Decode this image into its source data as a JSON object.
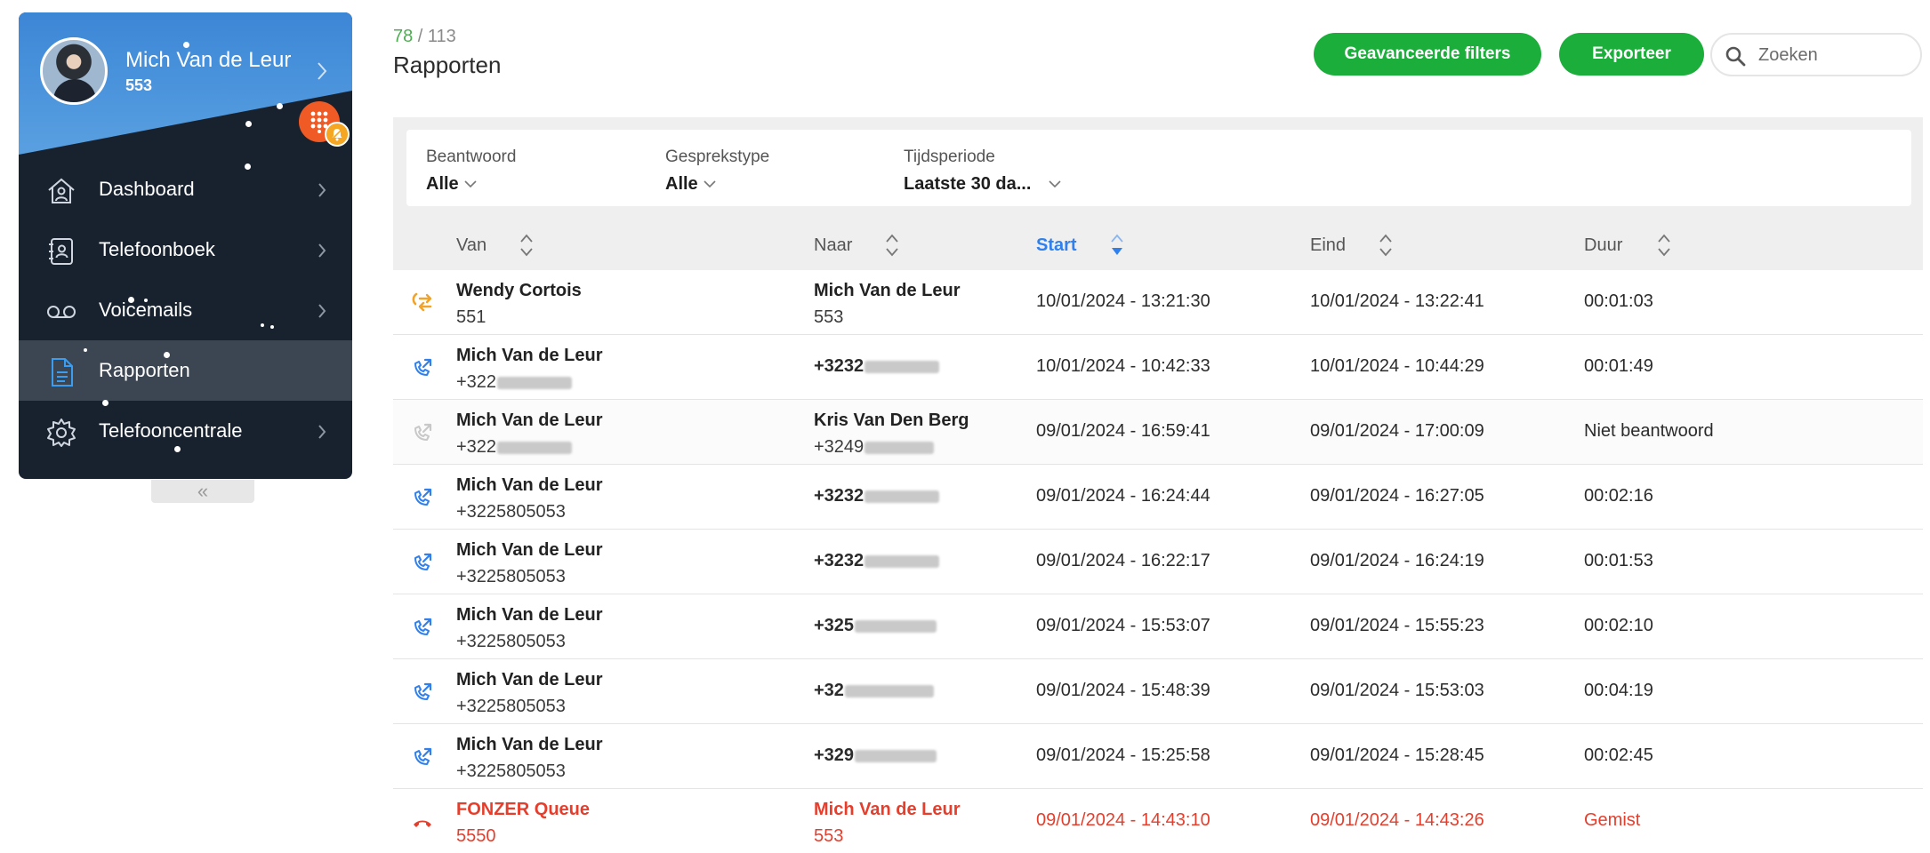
{
  "sidebar": {
    "user_name": "Mich Van de Leur",
    "user_ext": "553",
    "nav": [
      {
        "label": "Dashboard",
        "icon": "home-icon",
        "active": false
      },
      {
        "label": "Telefoonboek",
        "icon": "contacts-icon",
        "active": false
      },
      {
        "label": "Voicemails",
        "icon": "voicemail-icon",
        "active": false
      },
      {
        "label": "Rapporten",
        "icon": "document-icon",
        "active": true
      },
      {
        "label": "Telefooncentrale",
        "icon": "gear-icon",
        "active": false
      }
    ],
    "collapse_label": "«"
  },
  "header": {
    "count_current": "78",
    "count_separator": " / ",
    "count_total": "113",
    "title": "Rapporten",
    "advanced_filters_label": "Geavanceerde filters",
    "export_label": "Exporteer",
    "search_placeholder": "Zoeken"
  },
  "filters": [
    {
      "label": "Beantwoord",
      "value": "Alle"
    },
    {
      "label": "Gesprekstype",
      "value": "Alle"
    },
    {
      "label": "Tijdsperiode",
      "value": "Laatste 30 da..."
    }
  ],
  "columns": {
    "from": "Van",
    "to": "Naar",
    "start": "Start",
    "end": "Eind",
    "duration": "Duur"
  },
  "colors": {
    "accent_green": "#1bae3a",
    "sort_active_blue": "#2f80ed",
    "missed_red": "#e53e2c",
    "transfer_orange": "#f2a32a",
    "sidebar_bg": "#18222f"
  },
  "rows": [
    {
      "type": "transfer",
      "icon": "transfer-icon",
      "from_name": "Wendy Cortois",
      "from_number": "551",
      "to_name": "Mich Van de Leur",
      "to_number": "553",
      "start": "10/01/2024 - 13:21:30",
      "end": "10/01/2024 - 13:22:41",
      "duration": "00:01:03"
    },
    {
      "type": "outgoing",
      "icon": "outgoing-call-icon",
      "from_name": "Mich Van de Leur",
      "from_number": "+322",
      "to_name": "",
      "to_number": "+3232",
      "start": "10/01/2024 - 10:42:33",
      "end": "10/01/2024 - 10:44:29",
      "duration": "00:01:49"
    },
    {
      "type": "unanswered",
      "icon": "unanswered-call-icon",
      "from_name": "Mich Van de Leur",
      "from_number": "+322",
      "to_name": "Kris Van Den Berg",
      "to_number": "+3249",
      "start": "09/01/2024 - 16:59:41",
      "end": "09/01/2024 - 17:00:09",
      "duration": "Niet beantwoord"
    },
    {
      "type": "outgoing",
      "icon": "outgoing-call-icon",
      "from_name": "Mich Van de Leur",
      "from_number": "+3225805053",
      "to_name": "",
      "to_number": "+3232",
      "start": "09/01/2024 - 16:24:44",
      "end": "09/01/2024 - 16:27:05",
      "duration": "00:02:16"
    },
    {
      "type": "outgoing",
      "icon": "outgoing-call-icon",
      "from_name": "Mich Van de Leur",
      "from_number": "+3225805053",
      "to_name": "",
      "to_number": "+3232",
      "start": "09/01/2024 - 16:22:17",
      "end": "09/01/2024 - 16:24:19",
      "duration": "00:01:53"
    },
    {
      "type": "outgoing",
      "icon": "outgoing-call-icon",
      "from_name": "Mich Van de Leur",
      "from_number": "+3225805053",
      "to_name": "",
      "to_number": "+325",
      "start": "09/01/2024 - 15:53:07",
      "end": "09/01/2024 - 15:55:23",
      "duration": "00:02:10"
    },
    {
      "type": "outgoing",
      "icon": "outgoing-call-icon",
      "from_name": "Mich Van de Leur",
      "from_number": "+3225805053",
      "to_name": "",
      "to_number": "+32",
      "start": "09/01/2024 - 15:48:39",
      "end": "09/01/2024 - 15:53:03",
      "duration": "00:04:19"
    },
    {
      "type": "outgoing",
      "icon": "outgoing-call-icon",
      "from_name": "Mich Van de Leur",
      "from_number": "+3225805053",
      "to_name": "",
      "to_number": "+329",
      "start": "09/01/2024 - 15:25:58",
      "end": "09/01/2024 - 15:28:45",
      "duration": "00:02:45"
    },
    {
      "type": "missed",
      "icon": "missed-call-icon",
      "from_name": "FONZER Queue",
      "from_number": "5550",
      "to_name": "Mich Van de Leur",
      "to_number": "553",
      "start": "09/01/2024 - 14:43:10",
      "end": "09/01/2024 - 14:43:26",
      "duration": "Gemist"
    }
  ]
}
